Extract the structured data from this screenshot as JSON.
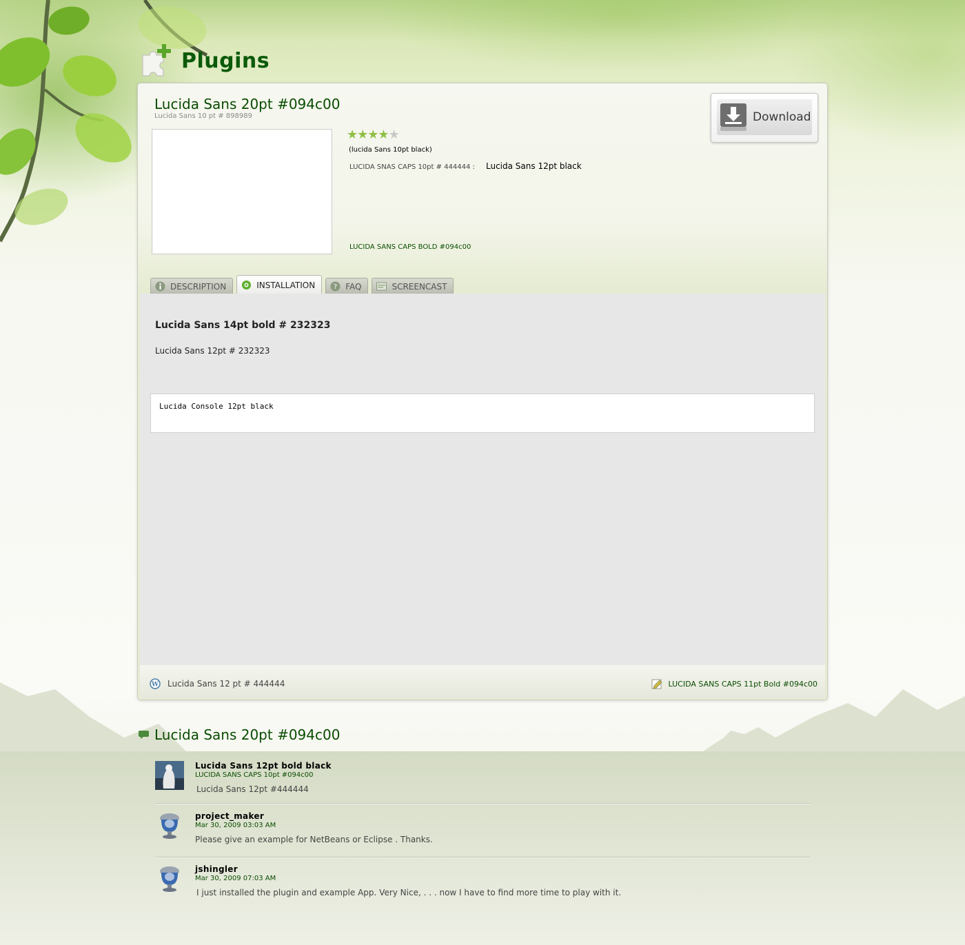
{
  "header": {
    "title": "Plugins",
    "icon": "puzzle-plus-icon"
  },
  "plugin": {
    "name": "Lucida Sans 20pt #094c00",
    "subtitle": "Lucida Sans 10 pt # 898989",
    "rating": {
      "value": 4,
      "max": 5
    },
    "rating_note": "(lucida Sans 10pt black)",
    "meta_label": "LUCIDA SNAS  CAPS 10pt # 444444 :",
    "meta_value": "Lucida Sans 12pt black",
    "meta_link": "LUCIDA SANS CAPS BOLD #094c00",
    "download_label": "Download"
  },
  "tabs": [
    {
      "label": "DESCRIPTION",
      "icon": "info-icon",
      "active": false
    },
    {
      "label": "INSTALLATION",
      "icon": "gear-icon",
      "active": true
    },
    {
      "label": "FAQ",
      "icon": "question-icon",
      "active": false
    },
    {
      "label": "SCREENCAST",
      "icon": "screen-icon",
      "active": false
    }
  ],
  "content": {
    "heading": "Lucida Sans 14pt bold # 232323",
    "text": "Lucida Sans 12pt # 232323",
    "code": "Lucida Console 12pt black"
  },
  "panel_footer": {
    "author": "Lucida Sans 12 pt # 444444",
    "link": "LUCIDA SANS CAPS 11pt Bold #094c00"
  },
  "comments": {
    "title": "Lucida Sans 20pt #094c00",
    "items": [
      {
        "author": "Lucida Sans 12pt bold black",
        "date": "LUCIDA SANS CAPS 10pt  #094c00",
        "text": "Lucida Sans 12pt #444444"
      },
      {
        "author": "project_maker",
        "date": "Mar 30, 2009 03:03 AM",
        "text": "Please give an example for NetBeans or Eclipse . Thanks."
      },
      {
        "author": "jshingler",
        "date": "Mar 30, 2009 07:03 AM",
        "text": "I just installed the plugin and example App. Very Nice, . . . now I have to find more time to play with it."
      }
    ]
  },
  "colors": {
    "brand_green": "#094c00",
    "muted": "#898989",
    "body_text": "#444444",
    "dark_text": "#232323"
  }
}
